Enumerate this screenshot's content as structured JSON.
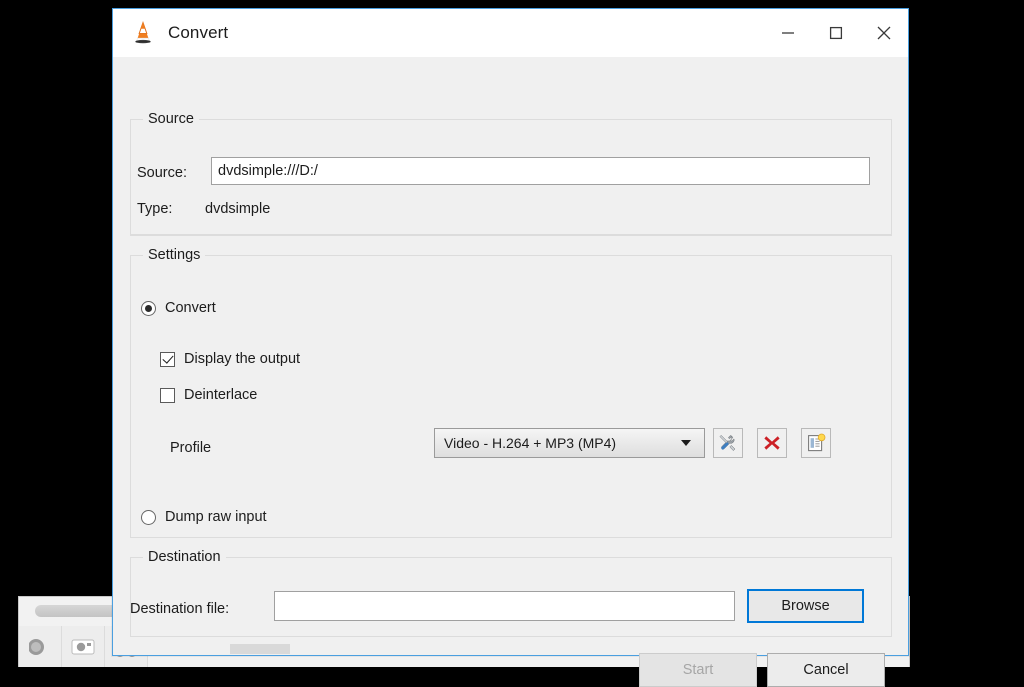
{
  "window": {
    "title": "Convert",
    "icon": "vlc-cone-icon",
    "controls": {
      "minimize": "minimize-icon",
      "maximize": "maximize-icon",
      "close": "close-icon"
    },
    "border_color": "#4a9fe0",
    "body_color": "#f0f0f0",
    "titlebar_color": "#ffffff"
  },
  "source": {
    "group_title": "Source",
    "source_label": "Source:",
    "source_value": "dvdsimple:///D:/",
    "source_placeholder": "",
    "type_label": "Type:",
    "type_value": "dvdsimple"
  },
  "settings": {
    "group_title": "Settings",
    "convert_radio": {
      "label": "Convert",
      "checked": true
    },
    "display_output_checkbox": {
      "label": "Display the output",
      "checked": true
    },
    "deinterlace_checkbox": {
      "label": "Deinterlace",
      "checked": false
    },
    "profile": {
      "label": "Profile",
      "selected": "Video - H.264 + MP3 (MP4)",
      "buttons": {
        "edit": "tools-icon",
        "delete": "red-x-icon",
        "create": "new-profile-icon"
      }
    },
    "dump_raw_radio": {
      "label": "Dump raw input",
      "checked": false
    }
  },
  "destination": {
    "group_title": "Destination",
    "file_label": "Destination file:",
    "file_value": "",
    "file_placeholder": "",
    "browse_button": "Browse",
    "browse_focus_color": "#0078d7"
  },
  "footer": {
    "start_button": "Start",
    "start_enabled": false,
    "cancel_button": "Cancel",
    "cancel_enabled": true
  },
  "background_window": {
    "toolbar_icons": [
      "record-icon",
      "snapshot-icon",
      "ab-loop-icon"
    ]
  }
}
